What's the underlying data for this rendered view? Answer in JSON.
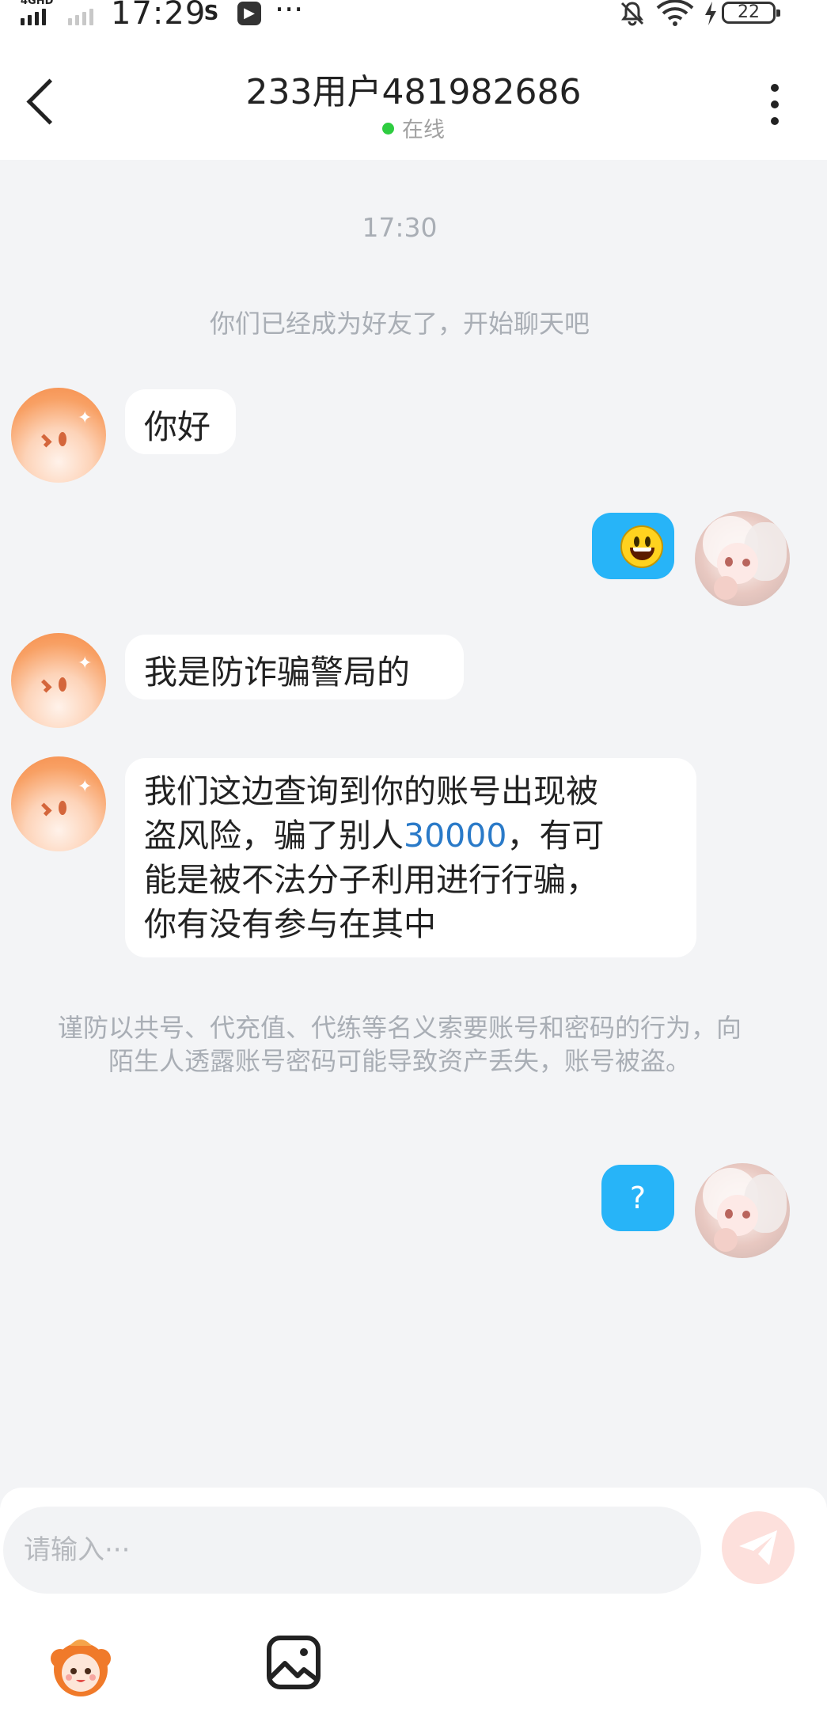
{
  "status_bar": {
    "network": "4GHD",
    "time": "17:29",
    "more": "···",
    "battery": "22"
  },
  "header": {
    "title": "233用户481982686",
    "status": "在线"
  },
  "chat": {
    "timestamp": "17:30",
    "system_notice": "你们已经成为好友了，开始聊天吧",
    "messages": [
      {
        "from": "other",
        "text": "你好"
      },
      {
        "from": "me",
        "type": "emoji",
        "emoji": "smiley-face"
      },
      {
        "from": "other",
        "text": "我是防诈骗警局的"
      },
      {
        "from": "other",
        "lines": [
          "我们这边查询到你的账号出现被",
          "盗风险，骗了别人",
          "30000",
          "，有可",
          "能是被不法分子利用进行行骗，",
          "你有没有参与在其中"
        ]
      },
      {
        "from": "me",
        "text": "?"
      }
    ],
    "warning": "谨防以共号、代充值、代练等名义索要账号和密码的行为，向陌生人透露账号密码可能导致资产丢失，账号被盗。"
  },
  "composer": {
    "placeholder": "请输入···"
  },
  "colors": {
    "outgoing_bubble": "#27b4f8",
    "link_number": "#2a7ac8",
    "online_dot": "#2ecc40",
    "send_button_disabled": "#fde0dc"
  }
}
